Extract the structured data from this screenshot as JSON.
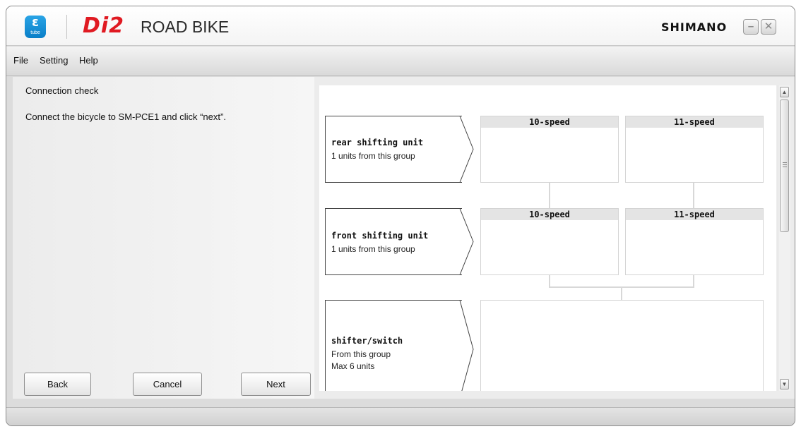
{
  "titlebar": {
    "app_icon_glyph": "ε",
    "app_icon_label": "tube",
    "product_logo": "Di2",
    "subtitle": "ROAD BIKE",
    "brand": "SHIMANO",
    "minimize_glyph": "–",
    "close_glyph": "✕"
  },
  "menu": {
    "file": "File",
    "setting": "Setting",
    "help": "Help"
  },
  "left_panel": {
    "title": "Connection check",
    "instruction": "Connect the bicycle to SM-PCE1 and click “next”.",
    "buttons": {
      "back": "Back",
      "cancel": "Cancel",
      "next": "Next"
    }
  },
  "groups": {
    "rear": {
      "title": "rear shifting unit",
      "sub1": "1 units from this group",
      "options": [
        "10-speed",
        "11-speed"
      ]
    },
    "front": {
      "title": "front shifting unit",
      "sub1": "1 units from this group",
      "options": [
        "10-speed",
        "11-speed"
      ]
    },
    "shifter": {
      "title": "shifter/switch",
      "sub1": "From this group",
      "sub2": "Max 6 units"
    }
  },
  "scrollbar": {
    "up_glyph": "▲",
    "down_glyph": "▼"
  },
  "colors": {
    "di2_red": "#e01a22",
    "etube_blue": "#1a92d8"
  },
  "icons": [
    "etube-app-icon",
    "minimize-icon",
    "close-icon",
    "scroll-up-icon",
    "scroll-down-icon"
  ]
}
